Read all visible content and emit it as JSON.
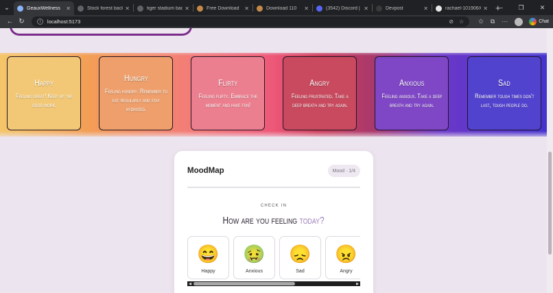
{
  "browser": {
    "tabs": [
      {
        "title": "GeauxWellness",
        "active": true,
        "fav_color": "#8ab4f8"
      },
      {
        "title": "Stock forest backg",
        "active": false,
        "fav_color": "#5f6368"
      },
      {
        "title": "tiger stadium backg",
        "active": false,
        "fav_color": "#5f6368"
      },
      {
        "title": "Free Download",
        "active": false,
        "fav_color": "#c58a4a"
      },
      {
        "title": "Download 110",
        "active": false,
        "fav_color": "#c58a4a"
      },
      {
        "title": "(3542) Discord | @",
        "active": false,
        "fav_color": "#5865f2"
      },
      {
        "title": "Devpost",
        "active": false,
        "fav_color": "#3a3a3a"
      },
      {
        "title": "rachael-101906/Ge",
        "active": false,
        "fav_color": "#e8e8e8"
      }
    ],
    "new_tab": "+",
    "url": "localhost:5173",
    "chat_label": "Chat"
  },
  "moods": [
    {
      "title": "Happy",
      "text": "Feeling great! Keep up the good work.",
      "bg": "#f2c877"
    },
    {
      "title": "Hungry",
      "text": "Feeling hungry. Remember to eat regularly and stay hydrated.",
      "bg": "#ee9f6b"
    },
    {
      "title": "Flirty",
      "text": "Feeling flirty. Embrace the moment and have fun!",
      "bg": "#ec7f8f"
    },
    {
      "title": "Angry",
      "text": "Feeling frustrated. Take a deep breath and try again.",
      "bg": "#c94a5e"
    },
    {
      "title": "Anxious",
      "text": "Feeling anxious. Take a deep breath and try again.",
      "bg": "#7f47c6"
    },
    {
      "title": "Sad",
      "text": "Remember tough times don't last, tough people do.",
      "bg": "#5243cf"
    }
  ],
  "moodmap": {
    "title": "MoodMap",
    "badge": "Mood · 1/4",
    "checkin": "CHECK IN",
    "question_main": "How are you feeling",
    "question_highlight": "today?",
    "options": [
      {
        "label": "Happy",
        "icon": "grinning-face-emoji",
        "glyph": "😄"
      },
      {
        "label": "Anxious",
        "icon": "nauseated-face-emoji",
        "glyph": "🤢"
      },
      {
        "label": "Sad",
        "icon": "sad-face-emoji",
        "glyph": "😞"
      },
      {
        "label": "Angry",
        "icon": "angry-face-emoji",
        "glyph": "😠"
      }
    ]
  }
}
